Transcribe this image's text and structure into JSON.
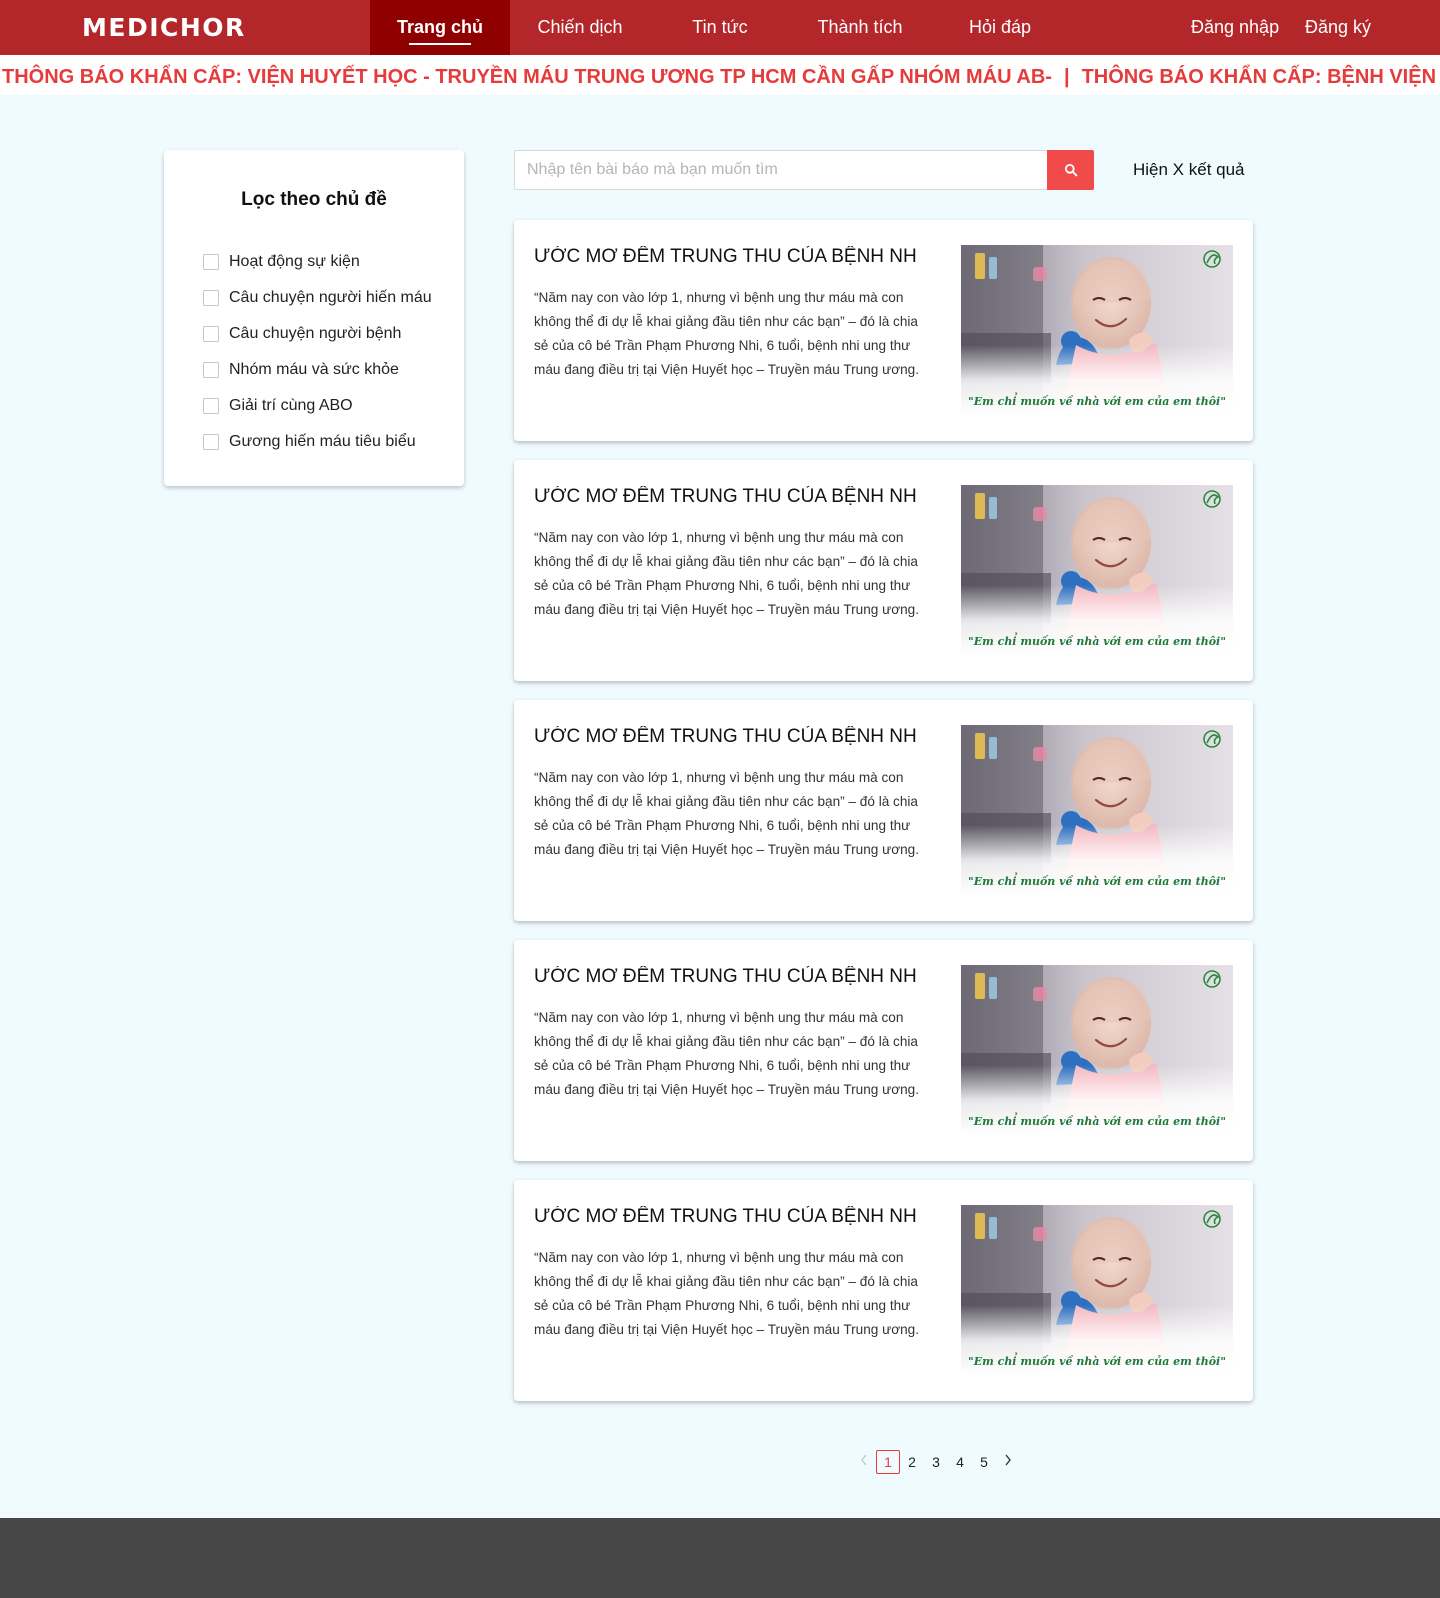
{
  "header": {
    "logo": "MEDICHOR",
    "nav": [
      {
        "label": "Trang chủ",
        "active": true
      },
      {
        "label": "Chiến dịch",
        "active": false
      },
      {
        "label": "Tin tức",
        "active": false
      },
      {
        "label": "Thành tích",
        "active": false
      },
      {
        "label": "Hỏi đáp",
        "active": false
      }
    ],
    "login": "Đăng nhập",
    "register": "Đăng ký"
  },
  "ticker": {
    "items": [
      "THÔNG BÁO KHẨN CẤP: VIỆN HUYẾT HỌC - TRUYỀN MÁU TRUNG ƯƠNG TP HCM CẦN GẤP NHÓM MÁU AB-",
      "THÔNG BÁO KHẨN CẤP: BỆNH VIỆN"
    ],
    "separator": "|"
  },
  "sidebar": {
    "title": "Lọc theo chủ đề",
    "filters": [
      {
        "label": "Hoạt động sự kiện",
        "checked": false
      },
      {
        "label": "Câu chuyện người hiến máu",
        "checked": false
      },
      {
        "label": "Câu chuyện người bệnh",
        "checked": false
      },
      {
        "label": "Nhóm máu và sức khỏe",
        "checked": false
      },
      {
        "label": "Giải trí cùng ABO",
        "checked": false
      },
      {
        "label": "Gương hiến máu tiêu biểu",
        "checked": false
      }
    ]
  },
  "search": {
    "placeholder": "Nhập tên bài báo mà bạn muốn tìm",
    "value": "",
    "icon": "search-icon",
    "result_count": "Hiện X kết quả"
  },
  "articles": [
    {
      "title": "ƯỚC MƠ ĐÊM TRUNG THU CỦA BỆNH NHI UNG THƯ MÁU",
      "excerpt": "“Năm nay con vào lớp 1, nhưng vì bệnh ung thư máu mà con không thể đi dự lễ khai giảng đầu tiên như các bạn” – đó là chia sẻ của cô bé Trần Phạm Phương Nhi, 6 tuổi, bệnh nhi ung thư máu đang điều trị tại Viện Huyết học – Truyền máu Trung ương.",
      "image_caption": "\"Em chỉ muốn về nhà với em của em thôi\""
    },
    {
      "title": "ƯỚC MƠ ĐÊM TRUNG THU CỦA BỆNH NHI UNG THƯ MÁU",
      "excerpt": "“Năm nay con vào lớp 1, nhưng vì bệnh ung thư máu mà con không thể đi dự lễ khai giảng đầu tiên như các bạn” – đó là chia sẻ của cô bé Trần Phạm Phương Nhi, 6 tuổi, bệnh nhi ung thư máu đang điều trị tại Viện Huyết học – Truyền máu Trung ương.",
      "image_caption": "\"Em chỉ muốn về nhà với em của em thôi\""
    },
    {
      "title": "ƯỚC MƠ ĐÊM TRUNG THU CỦA BỆNH NHI UNG THƯ MÁU",
      "excerpt": "“Năm nay con vào lớp 1, nhưng vì bệnh ung thư máu mà con không thể đi dự lễ khai giảng đầu tiên như các bạn” – đó là chia sẻ của cô bé Trần Phạm Phương Nhi, 6 tuổi, bệnh nhi ung thư máu đang điều trị tại Viện Huyết học – Truyền máu Trung ương.",
      "image_caption": "\"Em chỉ muốn về nhà với em của em thôi\""
    },
    {
      "title": "ƯỚC MƠ ĐÊM TRUNG THU CỦA BỆNH NHI UNG THƯ MÁU",
      "excerpt": "“Năm nay con vào lớp 1, nhưng vì bệnh ung thư máu mà con không thể đi dự lễ khai giảng đầu tiên như các bạn” – đó là chia sẻ của cô bé Trần Phạm Phương Nhi, 6 tuổi, bệnh nhi ung thư máu đang điều trị tại Viện Huyết học – Truyền máu Trung ương.",
      "image_caption": "\"Em chỉ muốn về nhà với em của em thôi\""
    },
    {
      "title": "ƯỚC MƠ ĐÊM TRUNG THU CỦA BỆNH NHI UNG THƯ MÁU",
      "excerpt": "“Năm nay con vào lớp 1, nhưng vì bệnh ung thư máu mà con không thể đi dự lễ khai giảng đầu tiên như các bạn” – đó là chia sẻ của cô bé Trần Phạm Phương Nhi, 6 tuổi, bệnh nhi ung thư máu đang điều trị tại Viện Huyết học – Truyền máu Trung ương.",
      "image_caption": "\"Em chỉ muốn về nhà với em của em thôi\""
    }
  ],
  "pagination": {
    "prev_icon": "chevron-left-icon",
    "next_icon": "chevron-right-icon",
    "pages": [
      "1",
      "2",
      "3",
      "4",
      "5"
    ],
    "current": "1"
  },
  "colors": {
    "header_bg": "#b3272b",
    "nav_active_bg": "#8f0000",
    "ticker_text": "#e63b3b",
    "search_button": "#f04a4a",
    "page_bg": "#f0fbff",
    "footer_bg": "#474747",
    "caption_green": "#1e7a3a"
  }
}
